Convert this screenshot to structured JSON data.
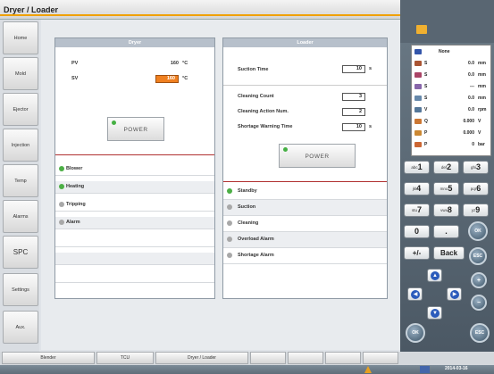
{
  "window": {
    "title": "Dryer / Loader"
  },
  "nav": [
    "Home",
    "Mold",
    "Ejector",
    "Injection",
    "Temp",
    "Alarms",
    "SPC",
    "Settings",
    "Aux."
  ],
  "dryer": {
    "title": "Dryer",
    "pv_label": "PV",
    "pv_value": "160",
    "pv_unit": "°C",
    "sv_label": "SV",
    "sv_value": "160",
    "sv_unit": "°C",
    "power_label": "POWER",
    "status": [
      {
        "label": "Blower",
        "on": true
      },
      {
        "label": "Heating",
        "on": true
      },
      {
        "label": "Tripping",
        "on": false
      },
      {
        "label": "Alarm",
        "on": false
      }
    ]
  },
  "loader": {
    "title": "Loader",
    "suction_time_label": "Suction Time",
    "suction_time_value": "10",
    "suction_time_unit": "s",
    "cleaning_count_label": "Cleaning Count",
    "cleaning_count_value": "3",
    "cleaning_action_label": "Cleaning Action Num.",
    "cleaning_action_value": "2",
    "shortage_label": "Shortage Warning Time",
    "shortage_value": "10",
    "shortage_unit": "s",
    "power_label": "POWER",
    "status": [
      {
        "label": "Standby",
        "on": true
      },
      {
        "label": "Suction",
        "on": false
      },
      {
        "label": "Cleaning",
        "on": false
      },
      {
        "label": "Overload Alarm",
        "on": false
      },
      {
        "label": "Shortage Alarm",
        "on": false
      }
    ]
  },
  "bottom_tabs": [
    "Blender",
    "TCU",
    "Dryer / Loader"
  ],
  "status_date": "2014-03-16",
  "readout": [
    {
      "key": "",
      "value": "None",
      "unit": "",
      "icon_color": "#3355aa"
    },
    {
      "key": "S",
      "value": "0.0",
      "unit": "mm",
      "icon_color": "#aa5533"
    },
    {
      "key": "S",
      "value": "0.0",
      "unit": "mm",
      "icon_color": "#aa4466"
    },
    {
      "key": "S",
      "value": "---",
      "unit": "mm",
      "icon_color": "#8866aa"
    },
    {
      "key": "S",
      "value": "0.0",
      "unit": "mm",
      "icon_color": "#6688aa"
    },
    {
      "key": "V",
      "value": "0.0",
      "unit": "rpm",
      "icon_color": "#557799"
    },
    {
      "key": "Q",
      "value": "0.000",
      "unit": "V",
      "icon_color": "#cc7733"
    },
    {
      "key": "P",
      "value": "0.000",
      "unit": "V",
      "icon_color": "#cc8833"
    },
    {
      "key": "P",
      "value": "0",
      "unit": "bar",
      "icon_color": "#cc6633"
    }
  ],
  "keypad": {
    "k1": {
      "sub": "abc",
      "num": "1"
    },
    "k2": {
      "sub": "def",
      "num": "2"
    },
    "k3": {
      "sub": "ghi",
      "num": "3"
    },
    "k4": {
      "sub": "jkl",
      "num": "4"
    },
    "k5": {
      "sub": "mno",
      "num": "5"
    },
    "k6": {
      "sub": "pqr",
      "num": "6"
    },
    "k7": {
      "sub": "stu",
      "num": "7"
    },
    "k8": {
      "sub": "vwx",
      "num": "8"
    },
    "k9": {
      "sub": "yz",
      "num": "9"
    },
    "k0": "0",
    "dot": ".",
    "plusminus": "+/-",
    "back": "Back",
    "ok": "OK",
    "esc": "ESC"
  }
}
